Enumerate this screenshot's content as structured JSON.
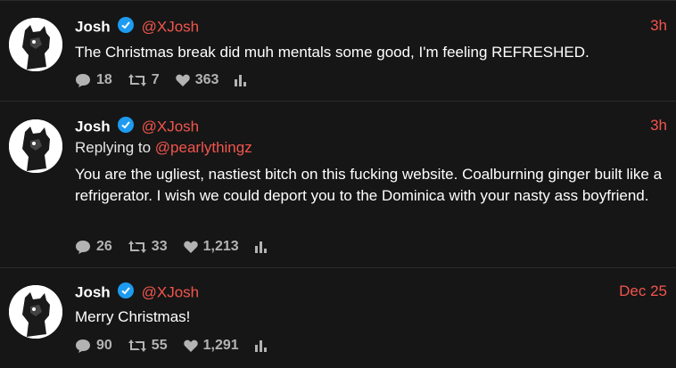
{
  "tweets": [
    {
      "name": "Josh",
      "handle": "@XJosh",
      "time": "3h",
      "replying_label": "",
      "replying_to": "",
      "text": "The Christmas break did muh mentals some good, I'm feeling REFRESHED.",
      "replies": "18",
      "retweets": "7",
      "likes": "363"
    },
    {
      "name": "Josh",
      "handle": "@XJosh",
      "time": "3h",
      "replying_label": "Replying to ",
      "replying_to": "@pearlythingz",
      "text": "You are the ugliest, nastiest bitch on this fucking website. Coalburning ginger built like a refrigerator. I wish we could deport you to the Dominica with your nasty ass boyfriend.",
      "replies": "26",
      "retweets": "33",
      "likes": "1,213"
    },
    {
      "name": "Josh",
      "handle": "@XJosh",
      "time": "Dec 25",
      "replying_label": "",
      "replying_to": "",
      "text": "Merry Christmas!",
      "replies": "90",
      "retweets": "55",
      "likes": "1,291"
    }
  ],
  "colors": {
    "background": "#161616",
    "accent": "#f2554d",
    "verified": "#1d9bf0",
    "muted": "#b3b3b3"
  },
  "icons": [
    "verified-icon",
    "reply-icon",
    "retweet-icon",
    "like-icon",
    "analytics-icon"
  ]
}
